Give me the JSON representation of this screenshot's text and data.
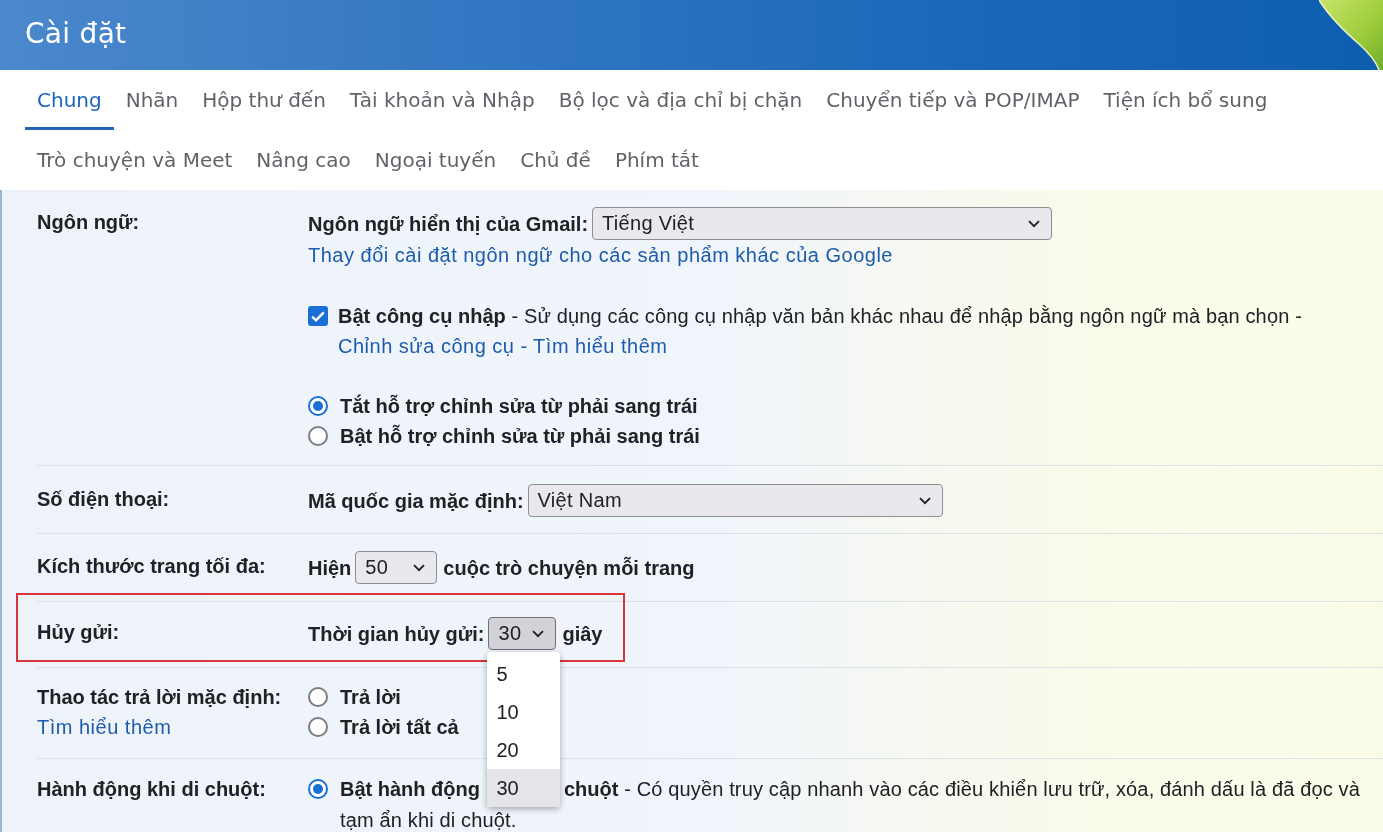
{
  "header": {
    "title": "Cài đặt"
  },
  "tab_rows": [
    {
      "tabs": [
        {
          "label": "Chung",
          "selected": true
        },
        {
          "label": "Nhãn",
          "selected": false
        },
        {
          "label": "Hộp thư đến",
          "selected": false
        },
        {
          "label": "Tài khoản và Nhập",
          "selected": false
        },
        {
          "label": "Bộ lọc và địa chỉ bị chặn",
          "selected": false
        },
        {
          "label": "Chuyển tiếp và POP/IMAP",
          "selected": false
        },
        {
          "label": "Tiện ích bổ sung",
          "selected": false
        }
      ]
    },
    {
      "tabs": [
        {
          "label": "Trò chuyện và Meet",
          "selected": false
        },
        {
          "label": "Nâng cao",
          "selected": false
        },
        {
          "label": "Ngoại tuyến",
          "selected": false
        },
        {
          "label": "Chủ đề",
          "selected": false
        },
        {
          "label": "Phím tắt",
          "selected": false
        }
      ]
    }
  ],
  "settings": {
    "language": {
      "label": "Ngôn ngữ:",
      "display_language": {
        "label": "Ngôn ngữ hiển thị của Gmail:",
        "value": "Tiếng Việt"
      },
      "link": "Thay đổi cài đặt ngôn ngữ cho các sản phẩm khác của Google",
      "input_tools": {
        "checked": true,
        "description": "**Bật công cụ nhập** - Sử dụng các công cụ nhập văn bản khác nhau để nhập bằng ngôn ngữ mà bạn chọn -",
        "links": [
          "Chỉnh sửa công cụ",
          "Tìm hiểu thêm"
        ],
        "link_separator": "-"
      },
      "direction_options": [
        {
          "label": "Tắt hỗ trợ chỉnh sửa từ phải sang trái",
          "selected": true
        },
        {
          "label": "Bật hỗ trợ chỉnh sửa từ phải sang trái",
          "selected": false
        }
      ]
    },
    "phone": {
      "label": "Số điện thoại:",
      "field_label": "Mã quốc gia mặc định:",
      "value": "Việt Nam"
    },
    "page_size": {
      "label": "Kích thước trang tối đa:",
      "prefix": "Hiện",
      "value": "50",
      "suffix": "cuộc trò chuyện mỗi trang"
    },
    "undo_send": {
      "label": "Hủy gửi:",
      "highlighted": true,
      "field_label": "Thời gian hủy gửi:",
      "value": "30",
      "expanded": true,
      "options": [
        {
          "label": "5",
          "selected": false
        },
        {
          "label": "10",
          "selected": false
        },
        {
          "label": "20",
          "selected": false
        },
        {
          "label": "30",
          "selected": true
        }
      ],
      "unit": "giây"
    },
    "reply": {
      "label": "Thao tác trả lời mặc định:",
      "link": "Tìm hiểu thêm",
      "options": [
        {
          "label": "Trả lời",
          "selected": false
        },
        {
          "label": "Trả lời tất cả",
          "selected": false
        }
      ]
    },
    "hover_actions": {
      "label": "Hành động khi di chuột:",
      "options": [
        {
          "selected": true,
          "visible_start": "Bật hành động",
          "visible_rest": "**chuột** - Có quyền truy cập nhanh vào các điều khiển lưu trữ, xóa, đánh dấu là đã đọc và",
          "second_line": "tạm ẩn khi di chuột."
        }
      ]
    }
  }
}
